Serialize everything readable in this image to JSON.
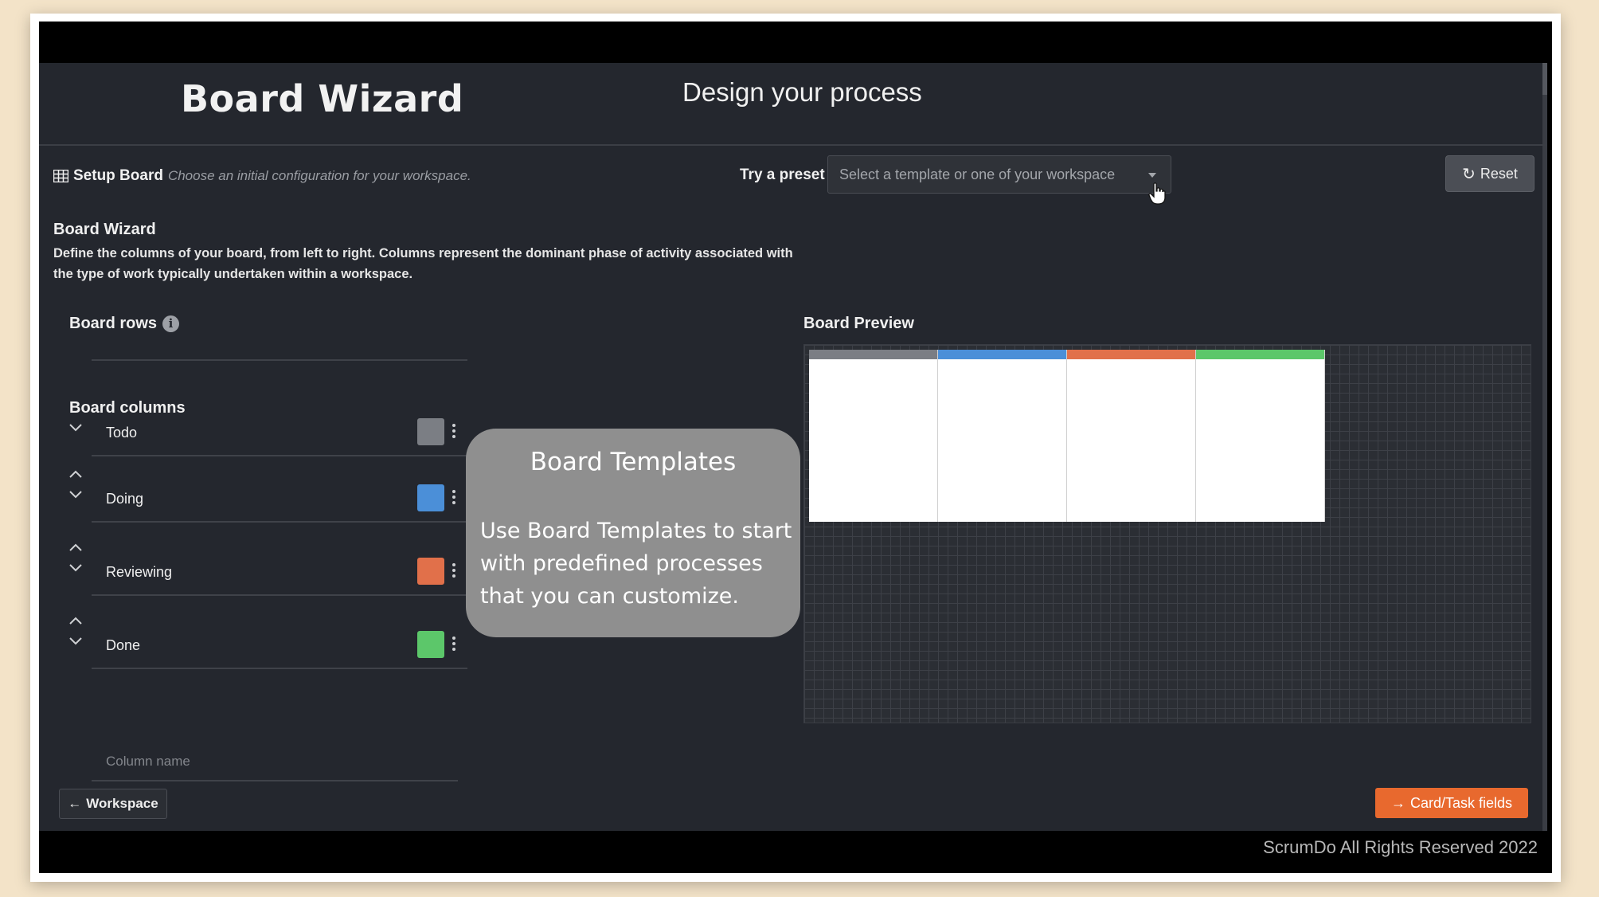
{
  "header": {
    "logo": "Board Wizard",
    "title": "Design your process"
  },
  "setup": {
    "icon": "grid-icon",
    "title": "Setup Board",
    "subtitle": "Choose an initial configuration for your workspace."
  },
  "preset": {
    "label": "Try a preset",
    "placeholder": "Select a template or one of your workspace"
  },
  "reset": {
    "icon": "refresh-icon",
    "label": "Reset"
  },
  "wizard": {
    "title": "Board Wizard",
    "description": "Define the columns of your board, from left to right. Columns represent the dominant phase of activity associated with the type of work typically undertaken within a workspace."
  },
  "board_rows": {
    "label": "Board rows",
    "icon": "info-icon"
  },
  "board_columns": {
    "label": "Board columns",
    "items": [
      {
        "name": "Todo",
        "color": "#7b7e84"
      },
      {
        "name": "Doing",
        "color": "#4b8fd8"
      },
      {
        "name": "Reviewing",
        "color": "#e1704a"
      },
      {
        "name": "Done",
        "color": "#5cc76a"
      }
    ],
    "new_placeholder": "Column name"
  },
  "preview": {
    "label": "Board Preview",
    "columns": [
      {
        "color": "#7b7e84"
      },
      {
        "color": "#4b8fd8"
      },
      {
        "color": "#e1704a"
      },
      {
        "color": "#5cc76a"
      }
    ]
  },
  "overlay": {
    "title": "Board Templates",
    "body": "Use Board Templates to start with predefined processes that you can customize."
  },
  "nav": {
    "back_label": "Workspace",
    "next_label": "Card/Task fields",
    "next_color": "#e8692e"
  },
  "footer": {
    "text": "ScrumDo All Rights Reserved 2022"
  }
}
